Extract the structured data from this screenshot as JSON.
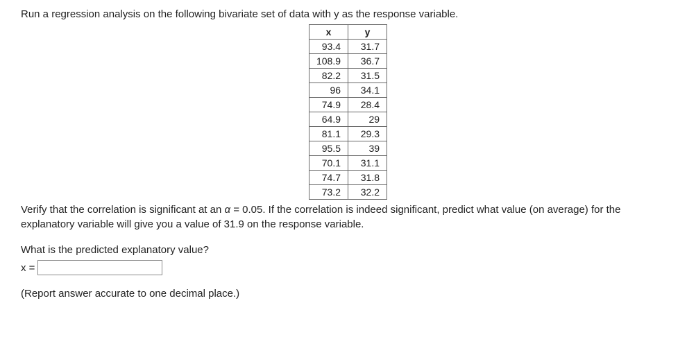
{
  "intro": "Run a regression analysis on the following bivariate set of data with y as the response variable.",
  "table": {
    "headers": {
      "x": "x",
      "y": "y"
    },
    "rows": [
      {
        "x": "93.4",
        "y": "31.7"
      },
      {
        "x": "108.9",
        "y": "36.7"
      },
      {
        "x": "82.2",
        "y": "31.5"
      },
      {
        "x": "96",
        "y": "34.1"
      },
      {
        "x": "74.9",
        "y": "28.4"
      },
      {
        "x": "64.9",
        "y": "29"
      },
      {
        "x": "81.1",
        "y": "29.3"
      },
      {
        "x": "95.5",
        "y": "39"
      },
      {
        "x": "70.1",
        "y": "31.1"
      },
      {
        "x": "74.7",
        "y": "31.8"
      },
      {
        "x": "73.2",
        "y": "32.2"
      }
    ]
  },
  "verify_text_pre": "Verify that the correlation is significant at an ",
  "alpha_sym": "α",
  "verify_text_mid": " = 0.05. If the correlation is indeed significant, predict what value (on average) for the explanatory variable will give you a value of 31.9 on the response variable.",
  "question": "What is the predicted explanatory value?",
  "answer_label": "x =",
  "answer_value": "",
  "report_hint": "(Report answer accurate to one decimal place.)"
}
